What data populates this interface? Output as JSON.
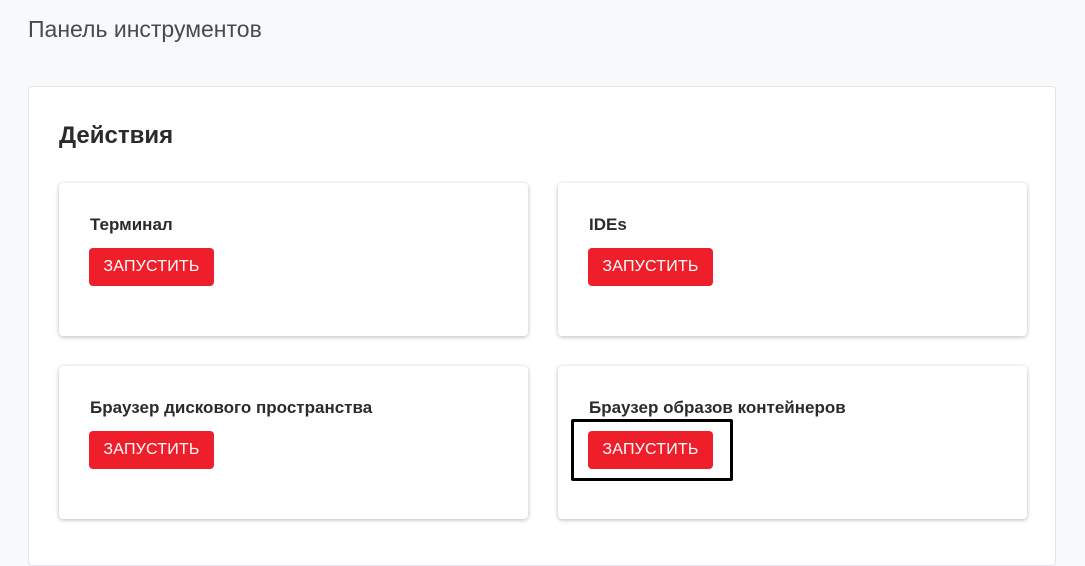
{
  "header": {
    "title": "Панель инструментов"
  },
  "panel": {
    "title": "Действия",
    "cards": [
      {
        "title": "Терминал",
        "button_label": "ЗАПУСТИТЬ"
      },
      {
        "title": "IDEs",
        "button_label": "ЗАПУСТИТЬ"
      },
      {
        "title": "Браузер дискового пространства",
        "button_label": "ЗАПУСТИТЬ"
      },
      {
        "title": "Браузер образов контейнеров",
        "button_label": "ЗАПУСТИТЬ"
      }
    ]
  },
  "colors": {
    "accent": "#ee1f2b",
    "background": "#f8f9fb",
    "highlight": "#000000"
  }
}
